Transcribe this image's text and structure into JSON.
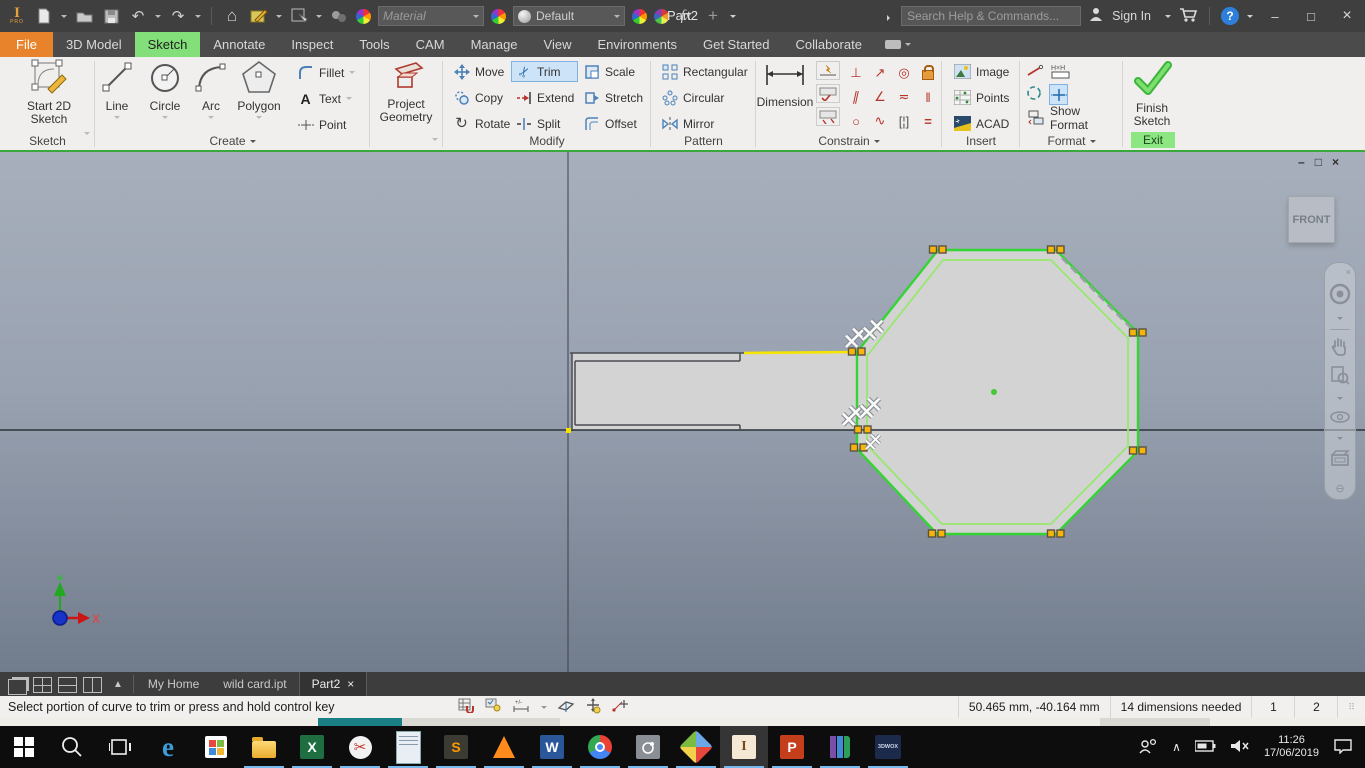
{
  "app": {
    "logo_letter": "I",
    "logo_sub": "PRO"
  },
  "titlebar": {
    "material": "Material",
    "appearance": "Default",
    "doc_title": "Part2",
    "search_placeholder": "Search Help & Commands...",
    "sign_in": "Sign In"
  },
  "tabs": [
    "File",
    "3D Model",
    "Sketch",
    "Annotate",
    "Inspect",
    "Tools",
    "CAM",
    "Manage",
    "View",
    "Environments",
    "Get Started",
    "Collaborate"
  ],
  "ribbon": {
    "sketch_panel": {
      "button": "Start 2D Sketch",
      "label": "Sketch"
    },
    "create": {
      "big": [
        "Line",
        "Circle",
        "Arc",
        "Polygon"
      ],
      "small": [
        "Fillet",
        "Text",
        "Point"
      ],
      "label": "Create"
    },
    "project_geometry": {
      "button": "Project Geometry"
    },
    "modify": {
      "items": [
        "Move",
        "Copy",
        "Rotate",
        "Trim",
        "Extend",
        "Split",
        "Scale",
        "Stretch",
        "Offset"
      ],
      "label": "Modify",
      "active_tool": "Trim"
    },
    "pattern": {
      "items": [
        "Rectangular",
        "Circular",
        "Mirror"
      ],
      "label": "Pattern"
    },
    "constrain": {
      "dimension": "Dimension",
      "label": "Constrain"
    },
    "insert": {
      "items": [
        "Image",
        "Points",
        "ACAD"
      ],
      "label": "Insert"
    },
    "format": {
      "show_format": "Show Format",
      "label": "Format",
      "hxh": "H×H"
    },
    "finish": {
      "button": "Finish Sketch",
      "label": "Exit"
    }
  },
  "canvas": {
    "viewcube": "FRONT",
    "x_axis_label": "X"
  },
  "doc_tabs": [
    {
      "label": "My Home"
    },
    {
      "label": "wild card.ipt"
    },
    {
      "label": "Part2"
    }
  ],
  "statusbar": {
    "prompt": "Select portion of curve to trim or press and hold control key",
    "coords": "50.465 mm, -40.164 mm",
    "dims_needed": "14 dimensions needed",
    "field1": "1",
    "field2": "2"
  },
  "taskbar": {
    "time": "11:26",
    "date": "17/06/2019"
  },
  "icons": {
    "undo": "↶",
    "redo": "↷",
    "home": "⌂",
    "fx": "fx",
    "plus": "+",
    "question": "?",
    "min": "–",
    "max": "□",
    "close": "×",
    "pencil": "✎",
    "text_tool": "A",
    "rotate": "↻",
    "trim_scissors": "✂",
    "snip_scissors": "✂",
    "excel": "X",
    "word": "W",
    "ppt": "P",
    "edge": "e",
    "sublime": "S",
    "dwox": "3DWOX",
    "inventor": "I",
    "chevron_up": "∧",
    "constrain_glyphs": [
      "⊥",
      "↗",
      "◎",
      "",
      "∥",
      "∠",
      "≂",
      "‖",
      "○",
      "∿",
      "[¦]",
      "="
    ],
    "colors": {
      "accent_green": "#37d437",
      "highlight_yellow": "#f5e400",
      "marker_orange": "#f7b50c",
      "select_blue": "#cde3f7"
    }
  }
}
